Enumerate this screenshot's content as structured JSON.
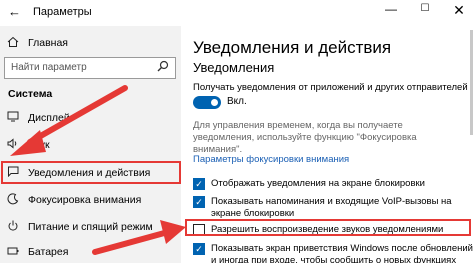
{
  "window": {
    "back_glyph": "←",
    "title": "Параметры",
    "minimize_glyph": "—",
    "maximize_glyph": "☐",
    "close_glyph": "✕"
  },
  "sidebar": {
    "home_label": "Главная",
    "search_placeholder": "Найти параметр",
    "section_title": "Система",
    "items": [
      {
        "label": "Дисплей",
        "icon": "display-icon"
      },
      {
        "label": "Звук",
        "icon": "sound-icon"
      },
      {
        "label": "Уведомления и действия",
        "icon": "notifications-icon",
        "active": true
      },
      {
        "label": "Фокусировка внимания",
        "icon": "focus-assist-icon"
      },
      {
        "label": "Питание и спящий режим",
        "icon": "power-icon"
      },
      {
        "label": "Батарея",
        "icon": "battery-icon"
      }
    ]
  },
  "main": {
    "title": "Уведомления и действия",
    "subtitle": "Уведомления",
    "get_notifications_text": "Получать уведомления от приложений и других отправителей",
    "toggle_label": "Вкл.",
    "toggle_on": true,
    "focus_info_line1": "Для управления временем, когда вы получаете",
    "focus_info_line2": "уведомления, используйте функцию \"Фокусировка",
    "focus_info_line3": "внимания\".",
    "focus_link": "Параметры фокусировки внимания",
    "checkboxes": [
      {
        "lines": [
          "Отображать уведомления на экране блокировки"
        ],
        "checked": true
      },
      {
        "lines": [
          "Показывать напоминания и входящие VoIP-вызовы на",
          "экране блокировки"
        ],
        "checked": true
      },
      {
        "lines": [
          "Разрешить  воспроизведение звуков уведомлениями"
        ],
        "checked": false,
        "highlighted": true
      },
      {
        "lines": [
          "Показывать экран приветствия Windows после обновлений",
          "и иногда при входе, чтобы сообщить о новых функциях"
        ],
        "checked": true
      }
    ]
  },
  "colors": {
    "accent": "#0063b1",
    "highlight": "#e53935",
    "sidebar_bg": "#f2f2f2",
    "link": "#1a5fb4"
  }
}
